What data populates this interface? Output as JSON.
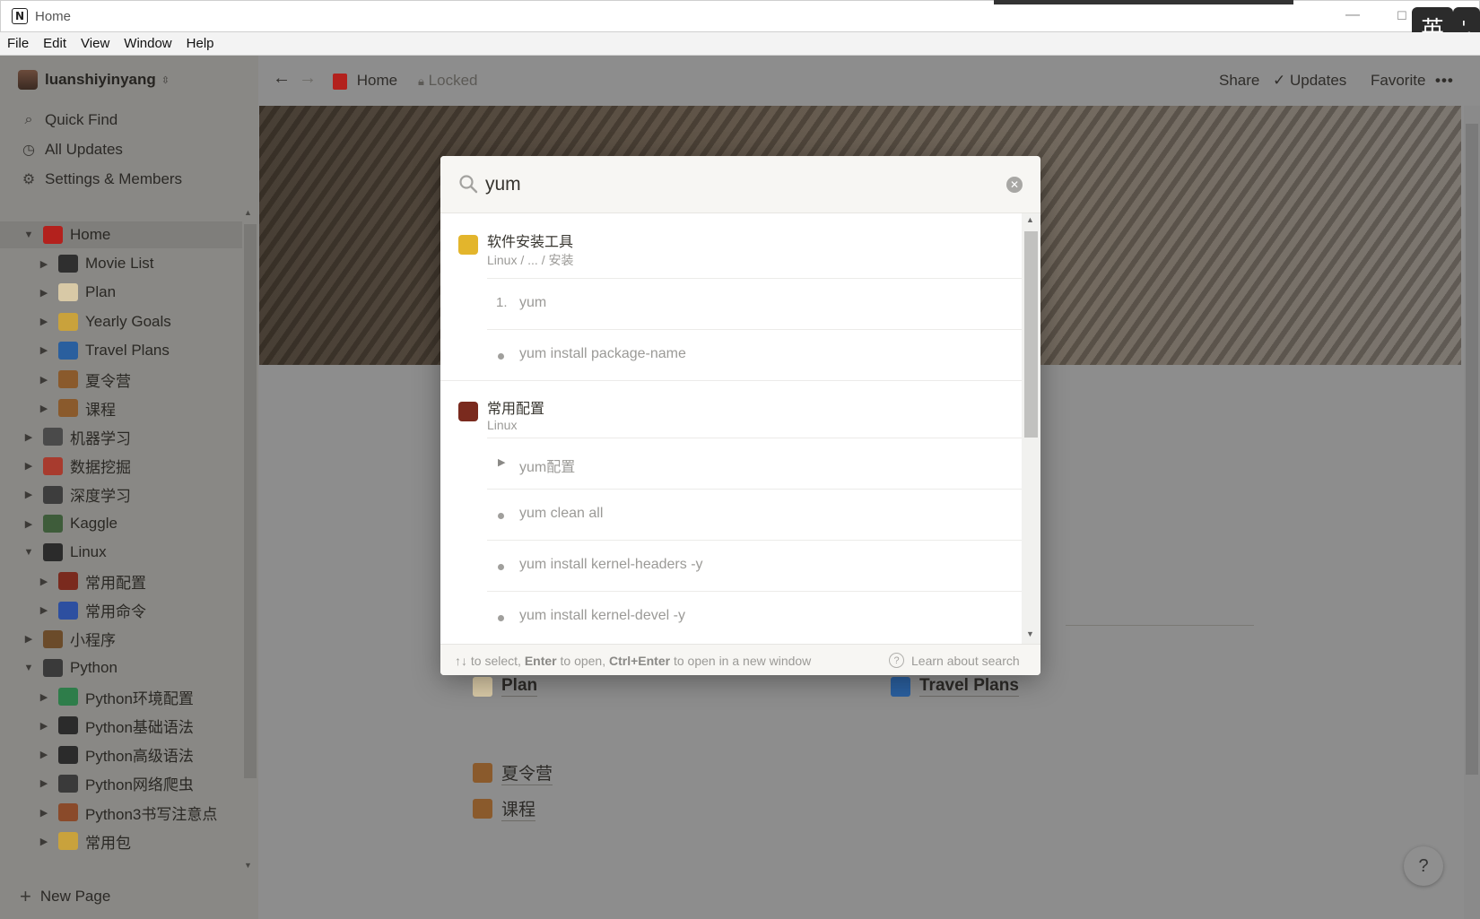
{
  "window": {
    "title": "Home",
    "app_logo": "N",
    "ime": [
      "英",
      "',"
    ]
  },
  "menu": [
    "File",
    "Edit",
    "View",
    "Window",
    "Help"
  ],
  "sidebar": {
    "workspace": "luanshiyinyang",
    "links": [
      {
        "label": "Quick Find",
        "icon": "search-icon"
      },
      {
        "label": "All Updates",
        "icon": "clock-icon"
      },
      {
        "label": "Settings & Members",
        "icon": "gear-icon"
      }
    ],
    "tree": [
      {
        "label": "Home",
        "depth": 0,
        "open": true,
        "selected": true,
        "color": "#b3211d"
      },
      {
        "label": "Movie List",
        "depth": 1,
        "color": "#2f2f2f"
      },
      {
        "label": "Plan",
        "depth": 1,
        "color": "#d8c9a6"
      },
      {
        "label": "Yearly Goals",
        "depth": 1,
        "color": "#c9a23c"
      },
      {
        "label": "Travel Plans",
        "depth": 1,
        "color": "#2a5f9e"
      },
      {
        "label": "夏令营",
        "depth": 1,
        "color": "#8a5a2c"
      },
      {
        "label": "课程",
        "depth": 1,
        "color": "#8a5a2c"
      },
      {
        "label": "机器学习",
        "depth": 0,
        "color": "#4a4a4a"
      },
      {
        "label": "数据挖掘",
        "depth": 0,
        "color": "#a83b2e"
      },
      {
        "label": "深度学习",
        "depth": 0,
        "color": "#3d3d3d"
      },
      {
        "label": "Kaggle",
        "depth": 0,
        "color": "#3e5c3a"
      },
      {
        "label": "Linux",
        "depth": 0,
        "open": true,
        "color": "#2b2b2b"
      },
      {
        "label": "常用配置",
        "depth": 1,
        "color": "#7a2a1e"
      },
      {
        "label": "常用命令",
        "depth": 1,
        "color": "#2d4fa0"
      },
      {
        "label": "小程序",
        "depth": 0,
        "color": "#6b4b2a"
      },
      {
        "label": "Python",
        "depth": 0,
        "open": true,
        "color": "#3a3a3a"
      },
      {
        "label": "Python环境配置",
        "depth": 1,
        "color": "#2e7d4a"
      },
      {
        "label": "Python基础语法",
        "depth": 1,
        "color": "#2b2b2b"
      },
      {
        "label": "Python高级语法",
        "depth": 1,
        "color": "#2b2b2b"
      },
      {
        "label": "Python网络爬虫",
        "depth": 1,
        "color": "#3a3a3a"
      },
      {
        "label": "Python3书写注意点",
        "depth": 1,
        "color": "#8a4a2a"
      },
      {
        "label": "常用包",
        "depth": 1,
        "color": "#c9a23c"
      }
    ],
    "new_page": "New Page"
  },
  "topbar": {
    "breadcrumb": "Home",
    "locked": "Locked",
    "share": "Share",
    "updates": "Updates",
    "favorite": "Favorite",
    "more": "•••"
  },
  "page": {
    "links": [
      {
        "label": "Plan",
        "bold": true,
        "color": "#d8c9a6"
      },
      {
        "label": "Travel Plans",
        "bold": true,
        "color": "#2a5f9e"
      },
      {
        "label": "夏令营",
        "bold": false,
        "color": "#8a5a2c"
      },
      {
        "label": "课程",
        "bold": false,
        "color": "#8a5a2c"
      }
    ],
    "help": "?"
  },
  "search": {
    "query": "yum",
    "results": [
      {
        "title": "软件安装工具",
        "path": "Linux / ... / 安装",
        "icon_color": "#e3b52c",
        "lines": [
          {
            "kind": "number",
            "mark": "1.",
            "text": "yum"
          },
          {
            "kind": "bullet",
            "text": "yum install package-name"
          }
        ]
      },
      {
        "title": "常用配置",
        "path": "Linux",
        "icon_color": "#7a2a1e",
        "lines": [
          {
            "kind": "toggle",
            "text": "yum配置"
          },
          {
            "kind": "bullet",
            "text": "yum clean all"
          },
          {
            "kind": "bullet",
            "text": "yum install kernel-headers -y"
          },
          {
            "kind": "bullet",
            "text": "yum install kernel-devel -y"
          }
        ]
      }
    ],
    "footer": {
      "arrows": "↑↓",
      "hint_to_select": " to select, ",
      "enter": "Enter",
      "hint_to_open": " to open, ",
      "ctrl_enter": "Ctrl+Enter",
      "hint_new_window": " to open in a new window",
      "learn": "Learn about search"
    }
  }
}
